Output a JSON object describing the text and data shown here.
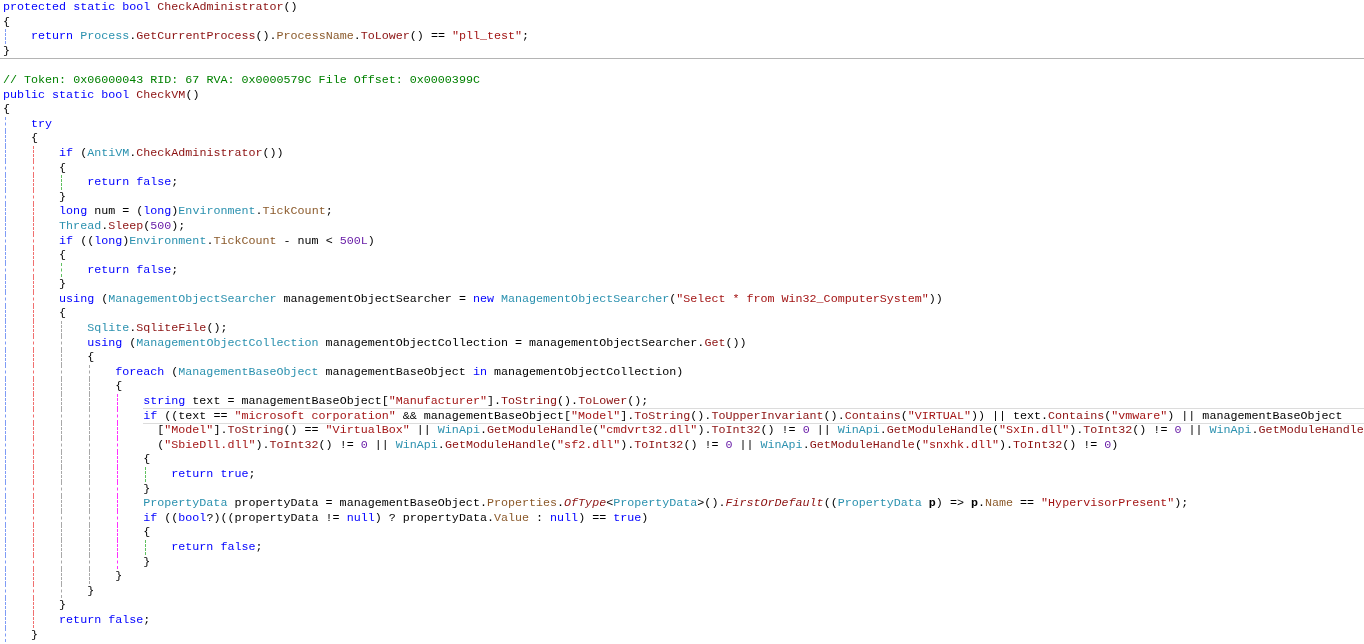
{
  "code": [
    {
      "kind": "line",
      "tokens": [
        {
          "kind": "keyword",
          "text": "protected static bool "
        },
        {
          "kind": "method",
          "text": "CheckAdministrator"
        },
        {
          "kind": "plain",
          "text": "()"
        }
      ]
    },
    {
      "kind": "line",
      "tokens": [
        {
          "kind": "plain",
          "text": "{"
        }
      ]
    },
    {
      "kind": "method",
      "children": [
        {
          "kind": "line",
          "tokens": [
            {
              "kind": "keyword",
              "text": "return "
            },
            {
              "kind": "type",
              "text": "Process"
            },
            {
              "kind": "plain",
              "text": "."
            },
            {
              "kind": "method",
              "text": "GetCurrentProcess"
            },
            {
              "kind": "plain",
              "text": "()."
            },
            {
              "kind": "property",
              "text": "ProcessName"
            },
            {
              "kind": "plain",
              "text": "."
            },
            {
              "kind": "method",
              "text": "ToLower"
            },
            {
              "kind": "plain",
              "text": "() == "
            },
            {
              "kind": "string",
              "text": "\"pll_test\""
            },
            {
              "kind": "plain",
              "text": ";"
            }
          ]
        }
      ]
    },
    {
      "kind": "line",
      "tokens": [
        {
          "kind": "plain",
          "text": "}"
        }
      ]
    },
    {
      "kind": "separator"
    },
    {
      "kind": "line",
      "tokens": [
        {
          "kind": "comment",
          "text": "// Token: 0x06000043 RID: 67 RVA: 0x0000579C File Offset: 0x0000399C"
        }
      ]
    },
    {
      "kind": "line",
      "tokens": [
        {
          "kind": "keyword",
          "text": "public static bool "
        },
        {
          "kind": "method",
          "text": "CheckVM"
        },
        {
          "kind": "plain",
          "text": "()"
        }
      ]
    },
    {
      "kind": "line",
      "tokens": [
        {
          "kind": "plain",
          "text": "{"
        }
      ]
    },
    {
      "kind": "method",
      "children": [
        {
          "kind": "line",
          "tokens": [
            {
              "kind": "keyword",
              "text": "try"
            }
          ]
        },
        {
          "kind": "line",
          "tokens": [
            {
              "kind": "plain",
              "text": "{"
            }
          ]
        },
        {
          "kind": "try",
          "children": [
            {
              "kind": "line",
              "tokens": [
                {
                  "kind": "keyword",
                  "text": "if "
                },
                {
                  "kind": "plain",
                  "text": "("
                },
                {
                  "kind": "type",
                  "text": "AntiVM"
                },
                {
                  "kind": "plain",
                  "text": "."
                },
                {
                  "kind": "method",
                  "text": "CheckAdministrator"
                },
                {
                  "kind": "plain",
                  "text": "())"
                }
              ]
            },
            {
              "kind": "line",
              "tokens": [
                {
                  "kind": "plain",
                  "text": "{"
                }
              ]
            },
            {
              "kind": "if",
              "children": [
                {
                  "kind": "line",
                  "tokens": [
                    {
                      "kind": "keyword",
                      "text": "return false"
                    },
                    {
                      "kind": "plain",
                      "text": ";"
                    }
                  ]
                }
              ]
            },
            {
              "kind": "line",
              "tokens": [
                {
                  "kind": "plain",
                  "text": "}"
                }
              ]
            },
            {
              "kind": "line",
              "tokens": [
                {
                  "kind": "keyword",
                  "text": "long "
                },
                {
                  "kind": "plain",
                  "text": "num = ("
                },
                {
                  "kind": "keyword",
                  "text": "long"
                },
                {
                  "kind": "plain",
                  "text": ")"
                },
                {
                  "kind": "type",
                  "text": "Environment"
                },
                {
                  "kind": "plain",
                  "text": "."
                },
                {
                  "kind": "property",
                  "text": "TickCount"
                },
                {
                  "kind": "plain",
                  "text": ";"
                }
              ]
            },
            {
              "kind": "line",
              "tokens": [
                {
                  "kind": "type",
                  "text": "Thread"
                },
                {
                  "kind": "plain",
                  "text": "."
                },
                {
                  "kind": "method",
                  "text": "Sleep"
                },
                {
                  "kind": "plain",
                  "text": "("
                },
                {
                  "kind": "number",
                  "text": "500"
                },
                {
                  "kind": "plain",
                  "text": ");"
                }
              ]
            },
            {
              "kind": "line",
              "tokens": [
                {
                  "kind": "keyword",
                  "text": "if "
                },
                {
                  "kind": "plain",
                  "text": "(("
                },
                {
                  "kind": "keyword",
                  "text": "long"
                },
                {
                  "kind": "plain",
                  "text": ")"
                },
                {
                  "kind": "type",
                  "text": "Environment"
                },
                {
                  "kind": "plain",
                  "text": "."
                },
                {
                  "kind": "property",
                  "text": "TickCount"
                },
                {
                  "kind": "plain",
                  "text": " - num < "
                },
                {
                  "kind": "number",
                  "text": "500L"
                },
                {
                  "kind": "plain",
                  "text": ")"
                }
              ]
            },
            {
              "kind": "line",
              "tokens": [
                {
                  "kind": "plain",
                  "text": "{"
                }
              ]
            },
            {
              "kind": "if",
              "children": [
                {
                  "kind": "line",
                  "tokens": [
                    {
                      "kind": "keyword",
                      "text": "return false"
                    },
                    {
                      "kind": "plain",
                      "text": ";"
                    }
                  ]
                }
              ]
            },
            {
              "kind": "line",
              "tokens": [
                {
                  "kind": "plain",
                  "text": "}"
                }
              ]
            },
            {
              "kind": "line",
              "tokens": [
                {
                  "kind": "keyword",
                  "text": "using "
                },
                {
                  "kind": "plain",
                  "text": "("
                },
                {
                  "kind": "type",
                  "text": "ManagementObjectSearcher"
                },
                {
                  "kind": "plain",
                  "text": " managementObjectSearcher = "
                },
                {
                  "kind": "keyword",
                  "text": "new "
                },
                {
                  "kind": "type",
                  "text": "ManagementObjectSearcher"
                },
                {
                  "kind": "plain",
                  "text": "("
                },
                {
                  "kind": "string",
                  "text": "\"Select * from Win32_ComputerSystem\""
                },
                {
                  "kind": "plain",
                  "text": "))"
                }
              ]
            },
            {
              "kind": "line",
              "tokens": [
                {
                  "kind": "plain",
                  "text": "{"
                }
              ]
            },
            {
              "kind": "using",
              "children": [
                {
                  "kind": "line",
                  "tokens": [
                    {
                      "kind": "type",
                      "text": "Sqlite"
                    },
                    {
                      "kind": "plain",
                      "text": "."
                    },
                    {
                      "kind": "method",
                      "text": "SqliteFile"
                    },
                    {
                      "kind": "plain",
                      "text": "();"
                    }
                  ]
                },
                {
                  "kind": "line",
                  "tokens": [
                    {
                      "kind": "keyword",
                      "text": "using "
                    },
                    {
                      "kind": "plain",
                      "text": "("
                    },
                    {
                      "kind": "type",
                      "text": "ManagementObjectCollection"
                    },
                    {
                      "kind": "plain",
                      "text": " managementObjectCollection = managementObjectSearcher."
                    },
                    {
                      "kind": "method",
                      "text": "Get"
                    },
                    {
                      "kind": "plain",
                      "text": "())"
                    }
                  ]
                },
                {
                  "kind": "line",
                  "tokens": [
                    {
                      "kind": "plain",
                      "text": "{"
                    }
                  ]
                },
                {
                  "kind": "using",
                  "children": [
                    {
                      "kind": "line",
                      "tokens": [
                        {
                          "kind": "keyword",
                          "text": "foreach "
                        },
                        {
                          "kind": "plain",
                          "text": "("
                        },
                        {
                          "kind": "type",
                          "text": "ManagementBaseObject"
                        },
                        {
                          "kind": "plain",
                          "text": " managementBaseObject "
                        },
                        {
                          "kind": "keyword",
                          "text": "in "
                        },
                        {
                          "kind": "plain",
                          "text": "managementObjectCollection)"
                        }
                      ]
                    },
                    {
                      "kind": "line",
                      "tokens": [
                        {
                          "kind": "plain",
                          "text": "{"
                        }
                      ]
                    },
                    {
                      "kind": "foreach",
                      "children": [
                        {
                          "kind": "line",
                          "tokens": [
                            {
                              "kind": "keyword",
                              "text": "string "
                            },
                            {
                              "kind": "plain",
                              "text": "text = managementBaseObject["
                            },
                            {
                              "kind": "string",
                              "text": "\"Manufacturer\""
                            },
                            {
                              "kind": "plain",
                              "text": "]."
                            },
                            {
                              "kind": "method",
                              "text": "ToString"
                            },
                            {
                              "kind": "plain",
                              "text": "()."
                            },
                            {
                              "kind": "method",
                              "text": "ToLower"
                            },
                            {
                              "kind": "plain",
                              "text": "();"
                            }
                          ]
                        },
                        {
                          "kind": "line",
                          "current": true,
                          "tokens": [
                            {
                              "kind": "keyword",
                              "text": "if "
                            },
                            {
                              "kind": "plain",
                              "text": "((text == "
                            },
                            {
                              "kind": "string",
                              "text": "\"microsoft corporation\""
                            },
                            {
                              "kind": "plain",
                              "text": " && managementBaseObject["
                            },
                            {
                              "kind": "string",
                              "text": "\"Model\""
                            },
                            {
                              "kind": "plain",
                              "text": "]."
                            },
                            {
                              "kind": "method",
                              "text": "ToString"
                            },
                            {
                              "kind": "plain",
                              "text": "()."
                            },
                            {
                              "kind": "method",
                              "text": "ToUpperInvariant"
                            },
                            {
                              "kind": "plain",
                              "text": "()."
                            },
                            {
                              "kind": "method",
                              "text": "Contains"
                            },
                            {
                              "kind": "plain",
                              "text": "("
                            },
                            {
                              "kind": "string",
                              "text": "\"VIRTUAL\""
                            },
                            {
                              "kind": "plain",
                              "text": ")) || text."
                            },
                            {
                              "kind": "method",
                              "text": "Contains"
                            },
                            {
                              "kind": "plain",
                              "text": "("
                            },
                            {
                              "kind": "string",
                              "text": "\"vmware\""
                            },
                            {
                              "kind": "plain",
                              "text": ") || managementBaseObject"
                            }
                          ]
                        },
                        {
                          "kind": "cont",
                          "tokens": [
                            {
                              "kind": "plain",
                              "text": "["
                            },
                            {
                              "kind": "string",
                              "text": "\"Model\""
                            },
                            {
                              "kind": "plain",
                              "text": "]."
                            },
                            {
                              "kind": "method",
                              "text": "ToString"
                            },
                            {
                              "kind": "plain",
                              "text": "() == "
                            },
                            {
                              "kind": "string",
                              "text": "\"VirtualBox\""
                            },
                            {
                              "kind": "plain",
                              "text": " || "
                            },
                            {
                              "kind": "type",
                              "text": "WinApi"
                            },
                            {
                              "kind": "plain",
                              "text": "."
                            },
                            {
                              "kind": "method",
                              "text": "GetModuleHandle"
                            },
                            {
                              "kind": "plain",
                              "text": "("
                            },
                            {
                              "kind": "string",
                              "text": "\"cmdvrt32.dll\""
                            },
                            {
                              "kind": "plain",
                              "text": ")."
                            },
                            {
                              "kind": "method",
                              "text": "ToInt32"
                            },
                            {
                              "kind": "plain",
                              "text": "() != "
                            },
                            {
                              "kind": "number",
                              "text": "0"
                            },
                            {
                              "kind": "plain",
                              "text": " || "
                            },
                            {
                              "kind": "type",
                              "text": "WinApi"
                            },
                            {
                              "kind": "plain",
                              "text": "."
                            },
                            {
                              "kind": "method",
                              "text": "GetModuleHandle"
                            },
                            {
                              "kind": "plain",
                              "text": "("
                            },
                            {
                              "kind": "string",
                              "text": "\"SxIn.dll\""
                            },
                            {
                              "kind": "plain",
                              "text": ")."
                            },
                            {
                              "kind": "method",
                              "text": "ToInt32"
                            },
                            {
                              "kind": "plain",
                              "text": "() != "
                            },
                            {
                              "kind": "number",
                              "text": "0"
                            },
                            {
                              "kind": "plain",
                              "text": " || "
                            },
                            {
                              "kind": "type",
                              "text": "WinApi"
                            },
                            {
                              "kind": "plain",
                              "text": "."
                            },
                            {
                              "kind": "method",
                              "text": "GetModuleHandle"
                            }
                          ]
                        },
                        {
                          "kind": "cont",
                          "tokens": [
                            {
                              "kind": "plain",
                              "text": "("
                            },
                            {
                              "kind": "string",
                              "text": "\"SbieDll.dll\""
                            },
                            {
                              "kind": "plain",
                              "text": ")."
                            },
                            {
                              "kind": "method",
                              "text": "ToInt32"
                            },
                            {
                              "kind": "plain",
                              "text": "() != "
                            },
                            {
                              "kind": "number",
                              "text": "0"
                            },
                            {
                              "kind": "plain",
                              "text": " || "
                            },
                            {
                              "kind": "type",
                              "text": "WinApi"
                            },
                            {
                              "kind": "plain",
                              "text": "."
                            },
                            {
                              "kind": "method",
                              "text": "GetModuleHandle"
                            },
                            {
                              "kind": "plain",
                              "text": "("
                            },
                            {
                              "kind": "string",
                              "text": "\"sf2.dll\""
                            },
                            {
                              "kind": "plain",
                              "text": ")."
                            },
                            {
                              "kind": "method",
                              "text": "ToInt32"
                            },
                            {
                              "kind": "plain",
                              "text": "() != "
                            },
                            {
                              "kind": "number",
                              "text": "0"
                            },
                            {
                              "kind": "plain",
                              "text": " || "
                            },
                            {
                              "kind": "type",
                              "text": "WinApi"
                            },
                            {
                              "kind": "plain",
                              "text": "."
                            },
                            {
                              "kind": "method",
                              "text": "GetModuleHandle"
                            },
                            {
                              "kind": "plain",
                              "text": "("
                            },
                            {
                              "kind": "string",
                              "text": "\"snxhk.dll\""
                            },
                            {
                              "kind": "plain",
                              "text": ")."
                            },
                            {
                              "kind": "method",
                              "text": "ToInt32"
                            },
                            {
                              "kind": "plain",
                              "text": "() != "
                            },
                            {
                              "kind": "number",
                              "text": "0"
                            },
                            {
                              "kind": "plain",
                              "text": ")"
                            }
                          ]
                        },
                        {
                          "kind": "line",
                          "tokens": [
                            {
                              "kind": "plain",
                              "text": "{"
                            }
                          ]
                        },
                        {
                          "kind": "if",
                          "children": [
                            {
                              "kind": "line",
                              "tokens": [
                                {
                                  "kind": "keyword",
                                  "text": "return true"
                                },
                                {
                                  "kind": "plain",
                                  "text": ";"
                                }
                              ]
                            }
                          ]
                        },
                        {
                          "kind": "line",
                          "tokens": [
                            {
                              "kind": "plain",
                              "text": "}"
                            }
                          ]
                        },
                        {
                          "kind": "line",
                          "tokens": [
                            {
                              "kind": "type",
                              "text": "PropertyData"
                            },
                            {
                              "kind": "plain",
                              "text": " propertyData = managementBaseObject."
                            },
                            {
                              "kind": "property",
                              "text": "Properties"
                            },
                            {
                              "kind": "plain",
                              "text": "."
                            },
                            {
                              "kind": "extension",
                              "text": "OfType"
                            },
                            {
                              "kind": "plain",
                              "text": "<"
                            },
                            {
                              "kind": "type",
                              "text": "PropertyData"
                            },
                            {
                              "kind": "plain",
                              "text": ">()."
                            },
                            {
                              "kind": "extension",
                              "text": "FirstOrDefault"
                            },
                            {
                              "kind": "plain",
                              "text": "(("
                            },
                            {
                              "kind": "type",
                              "text": "PropertyData "
                            },
                            {
                              "kind": "parameter",
                              "text": "p"
                            },
                            {
                              "kind": "plain",
                              "text": ") => "
                            },
                            {
                              "kind": "parameter",
                              "text": "p"
                            },
                            {
                              "kind": "plain",
                              "text": "."
                            },
                            {
                              "kind": "property",
                              "text": "Name"
                            },
                            {
                              "kind": "plain",
                              "text": " == "
                            },
                            {
                              "kind": "string",
                              "text": "\"HypervisorPresent\""
                            },
                            {
                              "kind": "plain",
                              "text": ");"
                            }
                          ]
                        },
                        {
                          "kind": "line",
                          "tokens": [
                            {
                              "kind": "keyword",
                              "text": "if "
                            },
                            {
                              "kind": "plain",
                              "text": "(("
                            },
                            {
                              "kind": "keyword",
                              "text": "bool"
                            },
                            {
                              "kind": "plain",
                              "text": "?)((propertyData != "
                            },
                            {
                              "kind": "keyword",
                              "text": "null"
                            },
                            {
                              "kind": "plain",
                              "text": ") ? propertyData."
                            },
                            {
                              "kind": "property",
                              "text": "Value"
                            },
                            {
                              "kind": "plain",
                              "text": " : "
                            },
                            {
                              "kind": "keyword",
                              "text": "null"
                            },
                            {
                              "kind": "plain",
                              "text": ") == "
                            },
                            {
                              "kind": "keyword",
                              "text": "true"
                            },
                            {
                              "kind": "plain",
                              "text": ")"
                            }
                          ]
                        },
                        {
                          "kind": "line",
                          "tokens": [
                            {
                              "kind": "plain",
                              "text": "{"
                            }
                          ]
                        },
                        {
                          "kind": "if",
                          "children": [
                            {
                              "kind": "line",
                              "tokens": [
                                {
                                  "kind": "keyword",
                                  "text": "return false"
                                },
                                {
                                  "kind": "plain",
                                  "text": ";"
                                }
                              ]
                            }
                          ]
                        },
                        {
                          "kind": "line",
                          "tokens": [
                            {
                              "kind": "plain",
                              "text": "}"
                            }
                          ]
                        }
                      ]
                    },
                    {
                      "kind": "line",
                      "tokens": [
                        {
                          "kind": "plain",
                          "text": "}"
                        }
                      ]
                    }
                  ]
                },
                {
                  "kind": "line",
                  "tokens": [
                    {
                      "kind": "plain",
                      "text": "}"
                    }
                  ]
                }
              ]
            },
            {
              "kind": "line",
              "tokens": [
                {
                  "kind": "plain",
                  "text": "}"
                }
              ]
            },
            {
              "kind": "line",
              "tokens": [
                {
                  "kind": "keyword",
                  "text": "return false"
                },
                {
                  "kind": "plain",
                  "text": ";"
                }
              ]
            }
          ]
        },
        {
          "kind": "line",
          "tokens": [
            {
              "kind": "plain",
              "text": "}"
            }
          ]
        }
      ]
    }
  ]
}
